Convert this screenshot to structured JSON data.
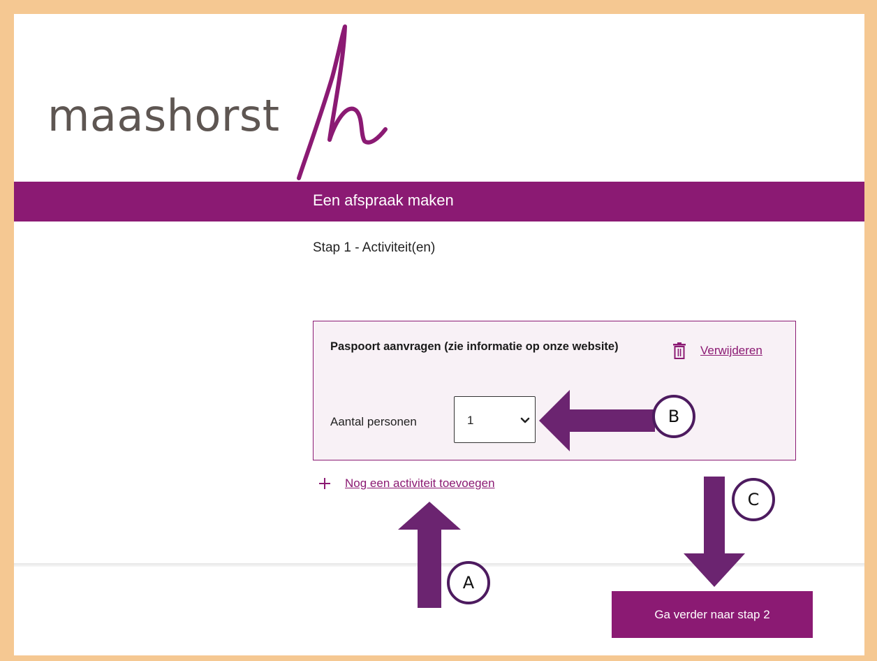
{
  "header": {
    "logo_text": "maashorst",
    "brand_color": "#8b1a73"
  },
  "banner": {
    "title": "Een afspraak maken"
  },
  "step": {
    "title": "Stap 1 - Activiteit(en)"
  },
  "activity": {
    "title": "Paspoort aanvragen (zie informatie op onze website)",
    "delete_label": "Verwijderen",
    "persons_label": "Aantal personen",
    "persons_value": "1"
  },
  "add_activity": {
    "label": "Nog een activiteit toevoegen"
  },
  "footer": {
    "next_label": "Ga verder naar stap 2"
  },
  "annotations": {
    "a": "A",
    "b": "B",
    "c": "C",
    "arrow_color": "#6b2470"
  },
  "icons": [
    "trash-icon",
    "plus-icon",
    "chevron-down-icon"
  ]
}
